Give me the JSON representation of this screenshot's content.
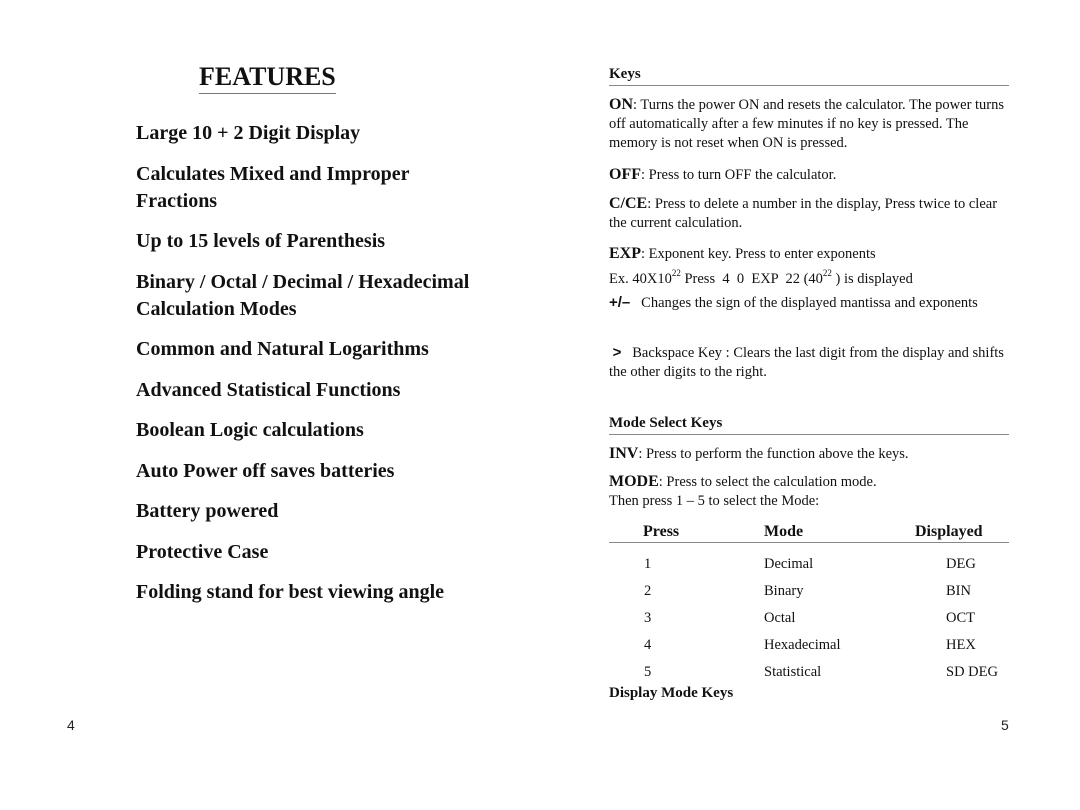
{
  "left_page": {
    "title": "FEATURES",
    "features": [
      "Large 10 + 2 Digit Display",
      "Calculates Mixed and Improper Fractions",
      "Up to 15 levels of Parenthesis",
      "Binary / Octal / Decimal / Hexadecimal Calculation Modes",
      "Common and Natural Logarithms",
      "Advanced Statistical Functions",
      "Boolean Logic calculations",
      "Auto Power off saves batteries",
      "Battery powered",
      "Protective Case",
      "Folding stand for best viewing angle"
    ],
    "page_number": "4"
  },
  "right_page": {
    "keys_heading": "Keys",
    "keys": {
      "on": {
        "key": "ON",
        "text": ": Turns the power ON and resets the calculator. The power turns off automatically after a few minutes if no key is pressed. The memory is not reset when ON is pressed."
      },
      "off": {
        "key": "OFF",
        "text": ": Press to turn OFF the calculator."
      },
      "cce": {
        "key": "C/CE",
        "text": ": Press to delete a number in the display, Press twice to clear the current calculation."
      },
      "exp": {
        "key": "EXP",
        "text": ": Exponent key. Press to enter exponents",
        "example_prefix": "Ex. 40X10",
        "example_sup1": "22",
        "example_mid": " Press  4  0  EXP  22 (40",
        "example_sup2": "22",
        "example_suffix": " ) is displayed"
      },
      "sign": {
        "key": "+/–",
        "text": "Changes the sign of the displayed mantissa and exponents"
      },
      "backspace": {
        "key": ">",
        "text": "Backspace Key : Clears the last digit from the display and shifts the other digits to the right."
      }
    },
    "mode_select_heading": "Mode Select Keys",
    "inv": {
      "key": "INV",
      "text": ": Press to perform the function above the keys."
    },
    "mode": {
      "key": "MODE",
      "text": ": Press to select the calculation mode.",
      "line2": "Then press 1 – 5 to select the Mode:"
    },
    "mode_table": {
      "headers": [
        "Press",
        "Mode",
        "Displayed"
      ],
      "rows": [
        [
          "1",
          "Decimal",
          "DEG"
        ],
        [
          "2",
          "Binary",
          "BIN"
        ],
        [
          "3",
          "Octal",
          "OCT"
        ],
        [
          "4",
          "Hexadecimal",
          "HEX"
        ],
        [
          "5",
          "Statistical",
          "SD DEG"
        ]
      ]
    },
    "display_mode_heading": "Display Mode Keys",
    "page_number": "5"
  }
}
